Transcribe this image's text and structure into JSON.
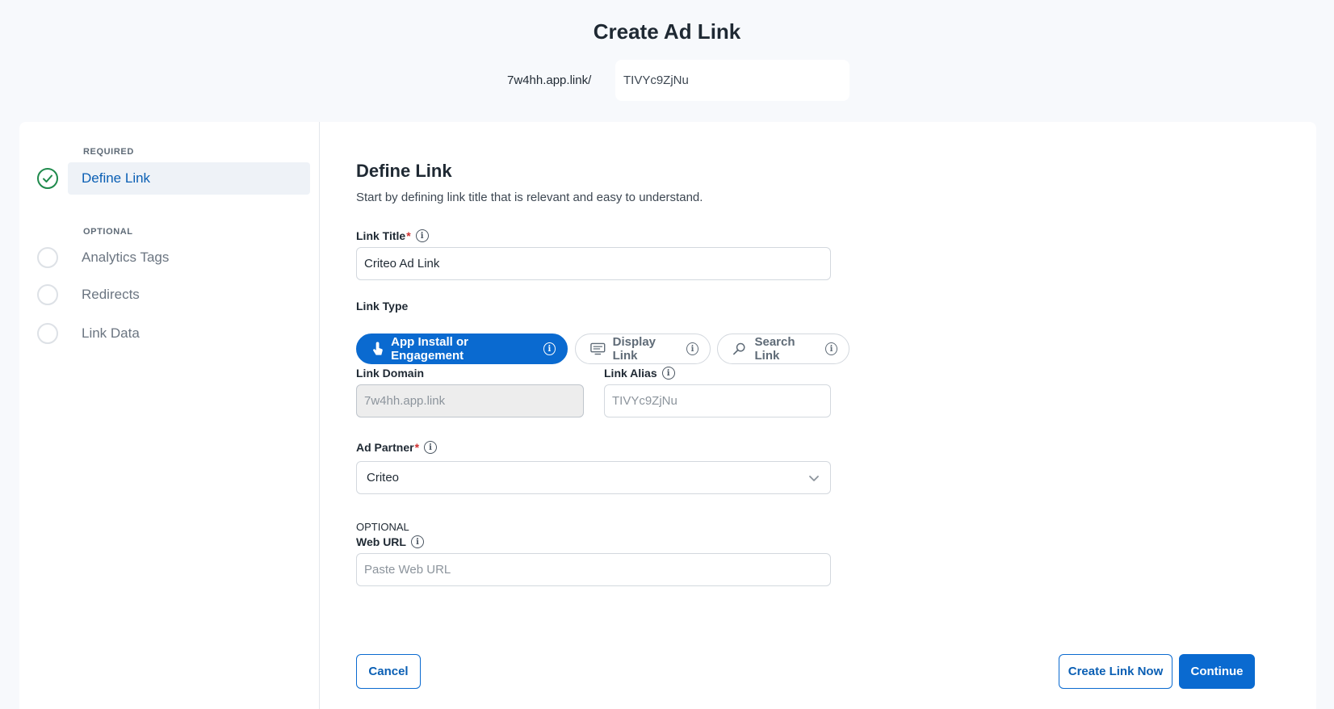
{
  "header": {
    "title": "Create Ad Link",
    "domain_prefix": "7w4hh.app.link/",
    "alias": "TIVYc9ZjNu"
  },
  "sidebar": {
    "required_label": "REQUIRED",
    "optional_label": "OPTIONAL",
    "steps": [
      {
        "label": "Define Link",
        "status": "complete",
        "active": true
      },
      {
        "label": "Analytics Tags",
        "status": "incomplete",
        "active": false
      },
      {
        "label": "Redirects",
        "status": "incomplete",
        "active": false
      },
      {
        "label": "Link Data",
        "status": "incomplete",
        "active": false
      }
    ]
  },
  "form": {
    "heading": "Define Link",
    "subtitle": "Start by defining link title that is relevant and easy to understand.",
    "link_title": {
      "label": "Link Title",
      "required_mark": "*",
      "value": "Criteo Ad Link"
    },
    "link_type": {
      "label": "Link Type",
      "options": [
        {
          "label": "App Install or Engagement",
          "selected": true
        },
        {
          "label": "Display Link",
          "selected": false
        },
        {
          "label": "Search Link",
          "selected": false
        }
      ]
    },
    "link_domain": {
      "label": "Link Domain",
      "value": "7w4hh.app.link"
    },
    "link_alias": {
      "label": "Link Alias",
      "placeholder": "TIVYc9ZjNu"
    },
    "ad_partner": {
      "label": "Ad Partner",
      "required_mark": "*",
      "value": "Criteo"
    },
    "web_url": {
      "optional_tag": "OPTIONAL",
      "label": "Web URL",
      "placeholder": "Paste Web URL"
    }
  },
  "actions": {
    "cancel": "Cancel",
    "create_now": "Create Link Now",
    "continue": "Continue"
  },
  "colors": {
    "primary": "#0a6ad0",
    "success": "#1f8a4c",
    "required": "#d0302f"
  }
}
